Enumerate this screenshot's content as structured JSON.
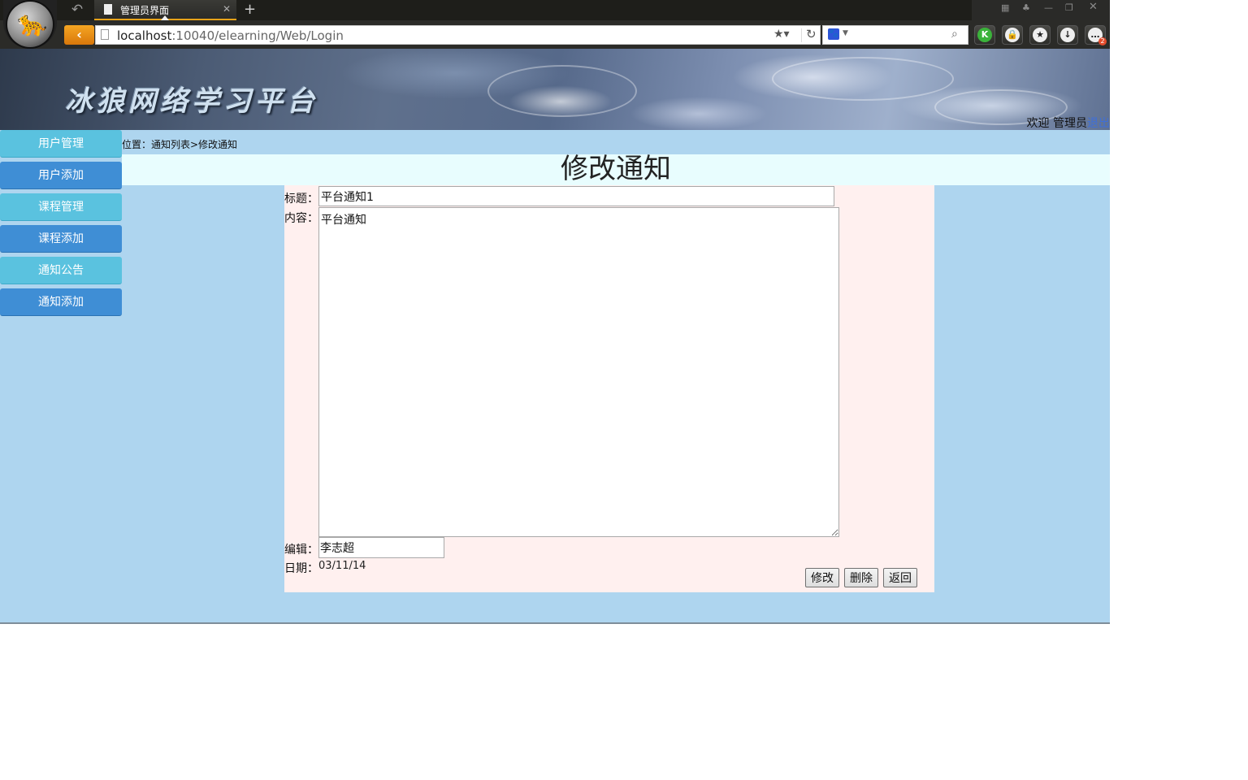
{
  "browser": {
    "tab_title": "管理员界面",
    "url_host": "localhost",
    "url_rest": ":10040/elearning/Web/Login",
    "badge_count": "2"
  },
  "header": {
    "site_title": "冰狼网络学习平台",
    "welcome_text": "欢迎 管理员",
    "logout_label": "退出"
  },
  "sidebar": {
    "items": [
      {
        "label": "用户管理"
      },
      {
        "label": "用户添加"
      },
      {
        "label": "课程管理"
      },
      {
        "label": "课程添加"
      },
      {
        "label": "通知公告"
      },
      {
        "label": "通知添加"
      }
    ]
  },
  "breadcrumb": "位置：通知列表>修改通知",
  "page_title": "修改通知",
  "form": {
    "title_label": "标题：",
    "title_value": "平台通知1",
    "content_label": "内容：",
    "content_value": "平台通知",
    "editor_label": "编辑：",
    "editor_value": "李志超",
    "date_label": "日期：",
    "date_value": "03/11/14"
  },
  "buttons": {
    "modify": "修改",
    "delete": "删除",
    "back": "返回"
  }
}
